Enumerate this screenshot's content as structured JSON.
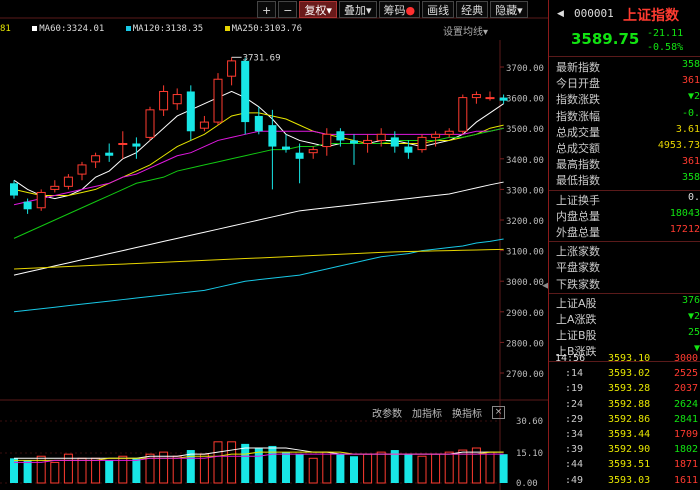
{
  "toolbar": {
    "buttons": [
      "+",
      "−",
      "复权▾",
      "叠加▾",
      "筹码",
      "画线",
      "经典",
      "隐藏▾"
    ]
  },
  "ma_legend": [
    {
      "label": "81",
      "color": "#e6e600"
    },
    {
      "label": "MA60:3324.01",
      "color": "#ffffff"
    },
    {
      "label": "MA120:3138.35",
      "color": "#18c8e6"
    },
    {
      "label": "MA250:3103.76",
      "color": "#e6d400"
    }
  ],
  "ma_setting": "设置均线▾",
  "price_axis": [
    "3700.00",
    "3600.00",
    "3500.00",
    "3400.00",
    "3300.00",
    "3200.00",
    "3100.00",
    "3000.00",
    "2900.00",
    "2800.00",
    "2700.00"
  ],
  "high_label": "3731.69",
  "volume_axis": [
    "30.60",
    "15.10",
    "0.00"
  ],
  "indicator_bar": {
    "params": "改参数",
    "add": "加指标",
    "switch": "换指标",
    "close": "×"
  },
  "header": {
    "code": "000001",
    "name": "上证指数",
    "price": "3589.75",
    "change": "-21.11",
    "change_pct": "-0.58%"
  },
  "quote_rows": [
    {
      "label": "最新指数",
      "value": "358",
      "cls": "green"
    },
    {
      "label": "今日开盘",
      "value": "361",
      "cls": "red"
    },
    {
      "label": "指数涨跌",
      "value": "▼2",
      "cls": "green"
    },
    {
      "label": "指数涨幅",
      "value": "-0.",
      "cls": "green"
    },
    {
      "label": "总成交量",
      "value": "3.61",
      "cls": "yellow"
    },
    {
      "label": "总成交额",
      "value": "4953.73",
      "cls": "yellow"
    },
    {
      "label": "最高指数",
      "value": "361",
      "cls": "red"
    },
    {
      "label": "最低指数",
      "value": "358",
      "cls": "green"
    }
  ],
  "turnover_rows": [
    {
      "label": "上证换手",
      "value": "0.",
      "cls": "white"
    },
    {
      "label": "内盘总量",
      "value": "18043",
      "cls": "green"
    },
    {
      "label": "外盘总量",
      "value": "17212",
      "cls": "red"
    }
  ],
  "breadth_rows": [
    {
      "label": "上涨家数",
      "value": "",
      "cls": "red"
    },
    {
      "label": "平盘家数",
      "value": "",
      "cls": "white"
    },
    {
      "label": "下跌家数",
      "value": "",
      "cls": "green"
    }
  ],
  "ab_rows": [
    {
      "label": "上证A股",
      "value": "376",
      "cls": "green"
    },
    {
      "label": "上A涨跌",
      "value": "▼2",
      "cls": "green"
    },
    {
      "label": "上证B股",
      "value": "25",
      "cls": "green"
    },
    {
      "label": "上B涨跌",
      "value": "▼",
      "cls": "green"
    }
  ],
  "ticks": [
    {
      "time": "14:56",
      "price": "3593.10",
      "vol": "3000",
      "cls": "red"
    },
    {
      "time": ":14",
      "price": "3593.02",
      "vol": "2525",
      "cls": "red"
    },
    {
      "time": ":19",
      "price": "3593.28",
      "vol": "2037",
      "cls": "red"
    },
    {
      "time": ":24",
      "price": "3592.88",
      "vol": "2624",
      "cls": "green"
    },
    {
      "time": ":29",
      "price": "3592.86",
      "vol": "2841",
      "cls": "green"
    },
    {
      "time": ":34",
      "price": "3593.44",
      "vol": "1709",
      "cls": "red"
    },
    {
      "time": ":39",
      "price": "3592.90",
      "vol": "1802",
      "cls": "green"
    },
    {
      "time": ":44",
      "price": "3593.51",
      "vol": "1871",
      "cls": "red"
    },
    {
      "time": ":49",
      "price": "3593.03",
      "vol": "1611",
      "cls": "red"
    }
  ],
  "chart_data": {
    "type": "candlestick",
    "ylim": [
      2650,
      3760
    ],
    "candles": [
      {
        "o": 3320,
        "h": 3330,
        "l": 3270,
        "c": 3280
      },
      {
        "o": 3260,
        "h": 3270,
        "l": 3220,
        "c": 3235
      },
      {
        "o": 3240,
        "h": 3300,
        "l": 3230,
        "c": 3290
      },
      {
        "o": 3300,
        "h": 3330,
        "l": 3290,
        "c": 3310
      },
      {
        "o": 3310,
        "h": 3350,
        "l": 3300,
        "c": 3340
      },
      {
        "o": 3350,
        "h": 3390,
        "l": 3330,
        "c": 3380
      },
      {
        "o": 3390,
        "h": 3420,
        "l": 3370,
        "c": 3410
      },
      {
        "o": 3420,
        "h": 3450,
        "l": 3390,
        "c": 3410
      },
      {
        "o": 3450,
        "h": 3490,
        "l": 3400,
        "c": 3450
      },
      {
        "o": 3450,
        "h": 3470,
        "l": 3400,
        "c": 3440
      },
      {
        "o": 3470,
        "h": 3570,
        "l": 3460,
        "c": 3560
      },
      {
        "o": 3560,
        "h": 3640,
        "l": 3540,
        "c": 3620
      },
      {
        "o": 3580,
        "h": 3630,
        "l": 3560,
        "c": 3610
      },
      {
        "o": 3620,
        "h": 3640,
        "l": 3460,
        "c": 3490
      },
      {
        "o": 3500,
        "h": 3540,
        "l": 3490,
        "c": 3520
      },
      {
        "o": 3520,
        "h": 3680,
        "l": 3510,
        "c": 3660
      },
      {
        "o": 3670,
        "h": 3731.69,
        "l": 3640,
        "c": 3720
      },
      {
        "o": 3720,
        "h": 3730,
        "l": 3480,
        "c": 3520
      },
      {
        "o": 3540,
        "h": 3570,
        "l": 3480,
        "c": 3490
      },
      {
        "o": 3510,
        "h": 3560,
        "l": 3300,
        "c": 3440
      },
      {
        "o": 3440,
        "h": 3480,
        "l": 3420,
        "c": 3430
      },
      {
        "o": 3420,
        "h": 3450,
        "l": 3320,
        "c": 3400
      },
      {
        "o": 3420,
        "h": 3440,
        "l": 3400,
        "c": 3430
      },
      {
        "o": 3440,
        "h": 3500,
        "l": 3410,
        "c": 3480
      },
      {
        "o": 3490,
        "h": 3500,
        "l": 3440,
        "c": 3460
      },
      {
        "o": 3460,
        "h": 3480,
        "l": 3380,
        "c": 3450
      },
      {
        "o": 3450,
        "h": 3480,
        "l": 3420,
        "c": 3460
      },
      {
        "o": 3460,
        "h": 3500,
        "l": 3440,
        "c": 3480
      },
      {
        "o": 3470,
        "h": 3490,
        "l": 3420,
        "c": 3440
      },
      {
        "o": 3440,
        "h": 3460,
        "l": 3400,
        "c": 3420
      },
      {
        "o": 3430,
        "h": 3480,
        "l": 3420,
        "c": 3470
      },
      {
        "o": 3470,
        "h": 3490,
        "l": 3440,
        "c": 3480
      },
      {
        "o": 3480,
        "h": 3500,
        "l": 3470,
        "c": 3490
      },
      {
        "o": 3490,
        "h": 3610,
        "l": 3480,
        "c": 3600
      },
      {
        "o": 3600,
        "h": 3620,
        "l": 3580,
        "c": 3610
      },
      {
        "o": 3600,
        "h": 3620,
        "l": 3590,
        "c": 3600
      },
      {
        "o": 3600,
        "h": 3610,
        "l": 3580,
        "c": 3590
      }
    ],
    "volumes": [
      12,
      11,
      13,
      10,
      14,
      12,
      12,
      11,
      13,
      12,
      14,
      15,
      13,
      16,
      14,
      20,
      20,
      19,
      17,
      18,
      15,
      14,
      12,
      15,
      14,
      13,
      14,
      15,
      16,
      14,
      13,
      14,
      15,
      16,
      17,
      15,
      14
    ],
    "vol_ylim": [
      0,
      30.6
    ],
    "ma_lines": [
      {
        "name": "MA5",
        "color": "#ffffff",
        "y": [
          3330,
          3300,
          3280,
          3270,
          3280,
          3300,
          3340,
          3360,
          3400,
          3420,
          3460,
          3500,
          3540,
          3560,
          3580,
          3600,
          3620,
          3600,
          3570,
          3530,
          3480,
          3460,
          3450,
          3440,
          3450,
          3450,
          3450,
          3460,
          3460,
          3450,
          3440,
          3450,
          3460,
          3480,
          3520,
          3550,
          3580
        ]
      },
      {
        "name": "MA10",
        "color": "#e6e600",
        "y": [
          3300,
          3290,
          3280,
          3280,
          3280,
          3290,
          3300,
          3320,
          3340,
          3360,
          3380,
          3410,
          3440,
          3460,
          3480,
          3510,
          3540,
          3550,
          3550,
          3540,
          3530,
          3510,
          3490,
          3480,
          3470,
          3460,
          3450,
          3450,
          3450,
          3450,
          3450,
          3460,
          3460,
          3470,
          3480,
          3500,
          3510
        ]
      },
      {
        "name": "MA20",
        "color": "#e018e0",
        "y": [
          3250,
          3260,
          3270,
          3280,
          3290,
          3300,
          3310,
          3320,
          3340,
          3350,
          3370,
          3390,
          3410,
          3420,
          3440,
          3460,
          3470,
          3480,
          3490,
          3490,
          3490,
          3490,
          3490,
          3480,
          3480,
          3480,
          3480,
          3480,
          3480,
          3480,
          3480,
          3480,
          3480,
          3480,
          3490,
          3490,
          3500
        ]
      },
      {
        "name": "MA30",
        "color": "#12c812",
        "y": [
          3140,
          3160,
          3180,
          3200,
          3220,
          3240,
          3260,
          3280,
          3300,
          3320,
          3330,
          3340,
          3360,
          3370,
          3380,
          3390,
          3400,
          3410,
          3420,
          3430,
          3430,
          3440,
          3440,
          3450,
          3450,
          3450,
          3450,
          3450,
          3460,
          3460,
          3460,
          3460,
          3470,
          3470,
          3480,
          3490,
          3500
        ]
      },
      {
        "name": "MA60",
        "color": "#ffffff",
        "y": [
          3020,
          3030,
          3040,
          3050,
          3060,
          3070,
          3080,
          3090,
          3100,
          3110,
          3120,
          3130,
          3140,
          3150,
          3160,
          3170,
          3180,
          3190,
          3200,
          3210,
          3220,
          3230,
          3235,
          3240,
          3245,
          3250,
          3255,
          3260,
          3265,
          3270,
          3275,
          3280,
          3285,
          3295,
          3305,
          3315,
          3324
        ]
      },
      {
        "name": "MA120",
        "color": "#18c8e6",
        "y": [
          2900,
          2905,
          2910,
          2915,
          2920,
          2925,
          2930,
          2935,
          2940,
          2945,
          2950,
          2955,
          2960,
          2965,
          2970,
          2980,
          2990,
          3000,
          3005,
          3010,
          3015,
          3020,
          3030,
          3040,
          3050,
          3060,
          3070,
          3080,
          3085,
          3090,
          3100,
          3105,
          3110,
          3115,
          3125,
          3130,
          3138
        ]
      },
      {
        "name": "MA250",
        "color": "#e6d400",
        "y": [
          3040,
          3042,
          3044,
          3046,
          3048,
          3050,
          3052,
          3054,
          3056,
          3058,
          3060,
          3062,
          3064,
          3066,
          3068,
          3070,
          3072,
          3074,
          3076,
          3078,
          3080,
          3082,
          3084,
          3086,
          3088,
          3090,
          3092,
          3094,
          3096,
          3097,
          3098,
          3099,
          3100,
          3101,
          3102,
          3103,
          3104
        ]
      }
    ],
    "vol_ma": [
      {
        "color": "#ffffff",
        "y": [
          12,
          12,
          12,
          12,
          12,
          12,
          12,
          12,
          12,
          12,
          13,
          13,
          13,
          14,
          14,
          15,
          16,
          17,
          17,
          17,
          17,
          16,
          15,
          15,
          14,
          14,
          14,
          14,
          14,
          14,
          14,
          14,
          14,
          15,
          15,
          15,
          15
        ]
      },
      {
        "color": "#e6e600",
        "y": [
          11,
          11,
          11,
          11,
          11,
          11,
          11,
          12,
          12,
          12,
          12,
          12,
          12,
          13,
          13,
          13,
          14,
          14,
          15,
          15,
          15,
          15,
          15,
          15,
          15,
          14,
          14,
          14,
          14,
          14,
          14,
          14,
          14,
          14,
          14,
          15,
          15
        ]
      },
      {
        "color": "#e018e0",
        "y": [
          10,
          10,
          10,
          11,
          11,
          11,
          11,
          11,
          11,
          11,
          12,
          12,
          12,
          12,
          12,
          13,
          13,
          13,
          13,
          14,
          14,
          14,
          14,
          14,
          14,
          14,
          14,
          14,
          14,
          14,
          14,
          14,
          14,
          14,
          14,
          14,
          14
        ]
      }
    ]
  }
}
